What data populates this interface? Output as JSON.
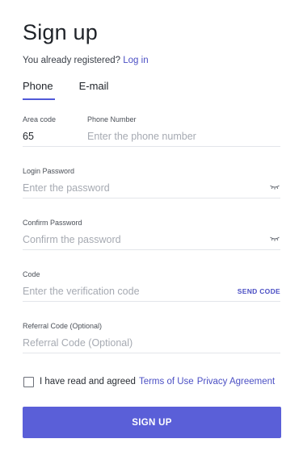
{
  "page": {
    "title": "Sign up",
    "registered_text": "You already registered?",
    "login_link": "Log in"
  },
  "tabs": [
    {
      "label": "Phone",
      "active": true
    },
    {
      "label": "E-mail",
      "active": false
    }
  ],
  "fields": {
    "area_code": {
      "label": "Area code",
      "value": "65"
    },
    "phone_number": {
      "label": "Phone Number",
      "placeholder": "Enter the phone number"
    },
    "login_password": {
      "label": "Login Password",
      "placeholder": "Enter the password",
      "icon": "eye-closed-icon"
    },
    "confirm_password": {
      "label": "Confirm Password",
      "placeholder": "Confirm the password",
      "icon": "eye-closed-icon"
    },
    "code": {
      "label": "Code",
      "placeholder": "Enter the verification code",
      "action": "SEND CODE"
    },
    "referral_code": {
      "label": "Referral Code (Optional)",
      "placeholder": "Referral Code (Optional)"
    }
  },
  "agreement": {
    "checked": false,
    "text": "I have read and agreed",
    "terms_link": "Terms of Use",
    "privacy_link": "Privacy Agreement"
  },
  "submit": {
    "label": "SIGN UP"
  },
  "colors": {
    "accent": "#5a5fd8",
    "link": "#4b4fc4",
    "placeholder": "#a6aab2",
    "divider": "#e3e5ea"
  }
}
